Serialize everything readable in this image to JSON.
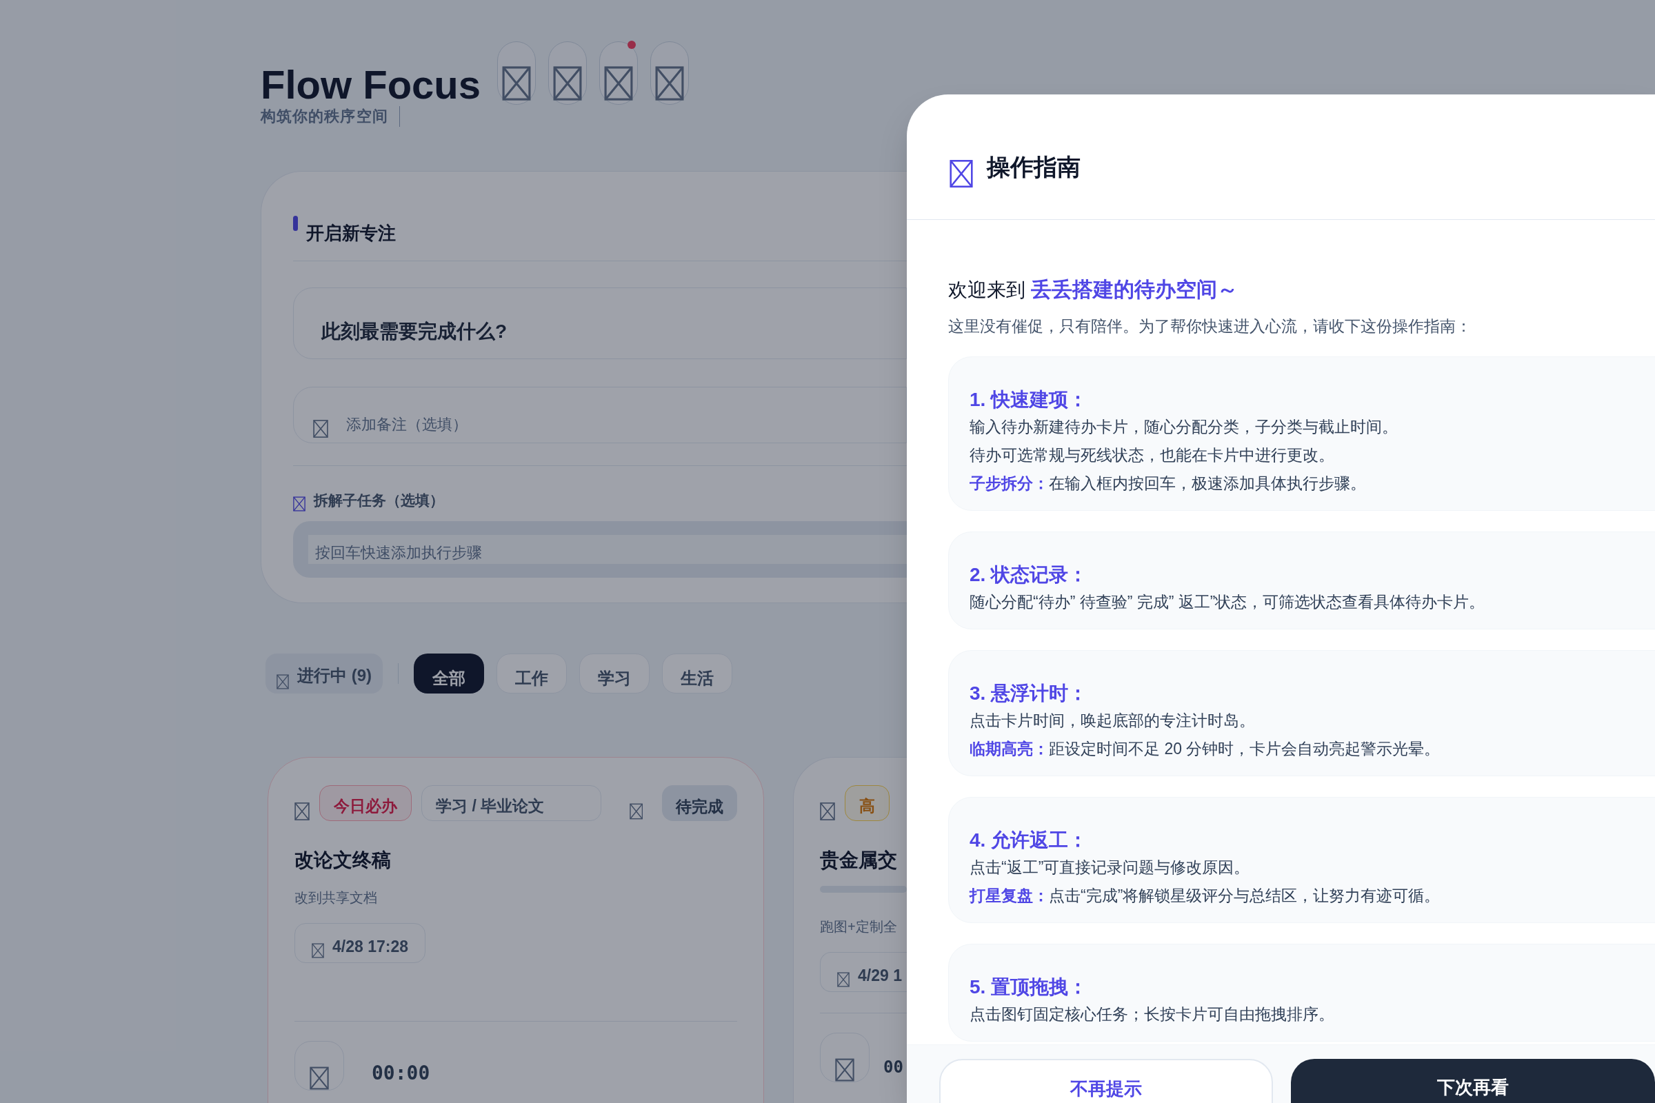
{
  "app": {
    "title": "Flow Focus",
    "subtitle": "构筑你的秩序空间",
    "header_buttons": [
      {
        "badge": false
      },
      {
        "badge": false
      },
      {
        "badge": true
      },
      {
        "badge": false
      }
    ]
  },
  "new_focus": {
    "title": "开启新专注",
    "task_placeholder": "此刻最需要完成什么?",
    "note_placeholder": "添加备注（选填）",
    "subtasks_label": "拆解子任务（选填）",
    "subtask_placeholder": "按回车快速添加执行步骤"
  },
  "filters": {
    "counter": "进行中 (9)",
    "tabs": [
      {
        "label": "全部",
        "selected": true
      },
      {
        "label": "工作",
        "selected": false
      },
      {
        "label": "学习",
        "selected": false
      },
      {
        "label": "生活",
        "selected": false
      }
    ]
  },
  "tasks": [
    {
      "tag": "今日必办",
      "kind": "urgent",
      "category": "学习 / 毕业论文",
      "status": "待完成",
      "title": "改论文终稿",
      "note": "改到共享文档",
      "due": "4/28 17:28",
      "timer": "00:00"
    },
    {
      "tag": "高",
      "kind": "high",
      "title": "贵金属交",
      "note": "跑图+定制全",
      "due": "4/29 1",
      "timer": "00"
    }
  ],
  "guide": {
    "title": "操作指南",
    "welcome": "欢迎来到 ",
    "welcome_highlight": "丢丢搭建的待办空间～",
    "intro": "这里没有催促，只有陪伴。为了帮你快速进入心流，请收下这份操作指南：",
    "items": [
      {
        "heading": "1. 快速建项：",
        "lines": [
          "输入待办新建待办卡片，随心分配分类，子分类与截止时间。",
          "待办可选常规与死线状态，也能在卡片中进行更改。",
          "**子步拆分：**在输入框内按回车，极速添加具体执行步骤。"
        ]
      },
      {
        "heading": "2. 状态记录：",
        "lines": [
          "随心分配“待办” 待查验” 完成” 返工”状态，可筛选状态查看具体待办卡片。"
        ]
      },
      {
        "heading": "3. 悬浮计时：",
        "lines": [
          "点击卡片时间，唤起底部的专注计时岛。",
          "**临期高亮：**距设定时间不足 20 分钟时，卡片会自动亮起警示光晕。"
        ]
      },
      {
        "heading": "4. 允许返工：",
        "lines": [
          "点击“返工”可直接记录问题与修改原因。",
          "**打星复盘：**点击“完成”将解锁星级评分与总结区，让努力有迹可循。"
        ]
      },
      {
        "heading": "5. 置顶拖拽：",
        "lines": [
          "点击图钉固定核心任务；长按卡片可自由拖拽排序。"
        ]
      }
    ],
    "buttons": [
      {
        "label": "不再提示",
        "kind": "secondary"
      },
      {
        "label": "下次再看",
        "kind": "primary"
      }
    ]
  }
}
